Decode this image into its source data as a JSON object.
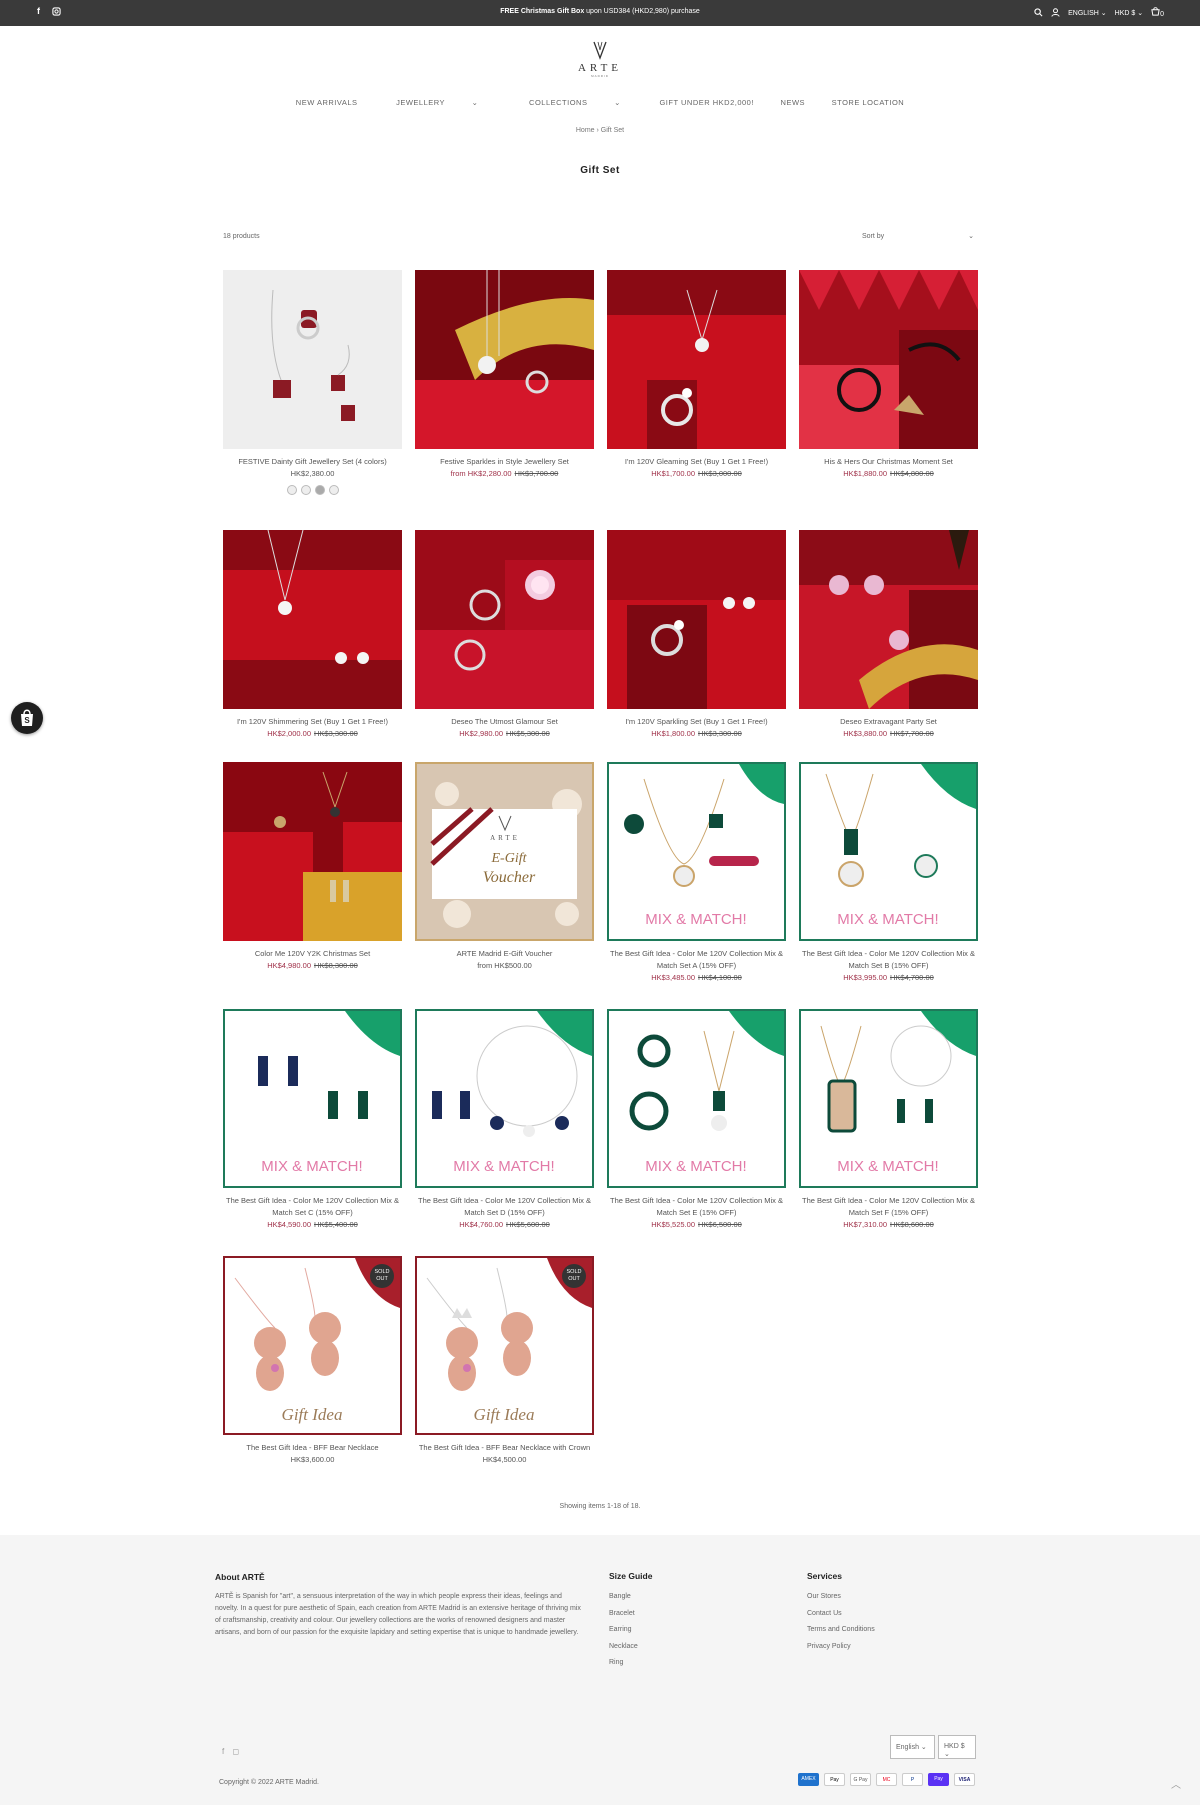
{
  "topbar": {
    "promo_bold": "FREE Christmas Gift Box",
    "promo_rest": " upon USD384 (HKD2,980) purchase",
    "language": "ENGLISH",
    "currency": "HKD $",
    "cart_count": "0"
  },
  "logo": {
    "text": "ARTE",
    "sub": "MADRID"
  },
  "nav": [
    "NEW ARRIVALS",
    "JEWELLERY",
    "COLLECTIONS",
    "GIFT UNDER HKD2,000!",
    "NEWS",
    "STORE LOCATION"
  ],
  "breadcrumb": "Home › Gift Set",
  "page_title": "Gift Set",
  "product_count": "18 products",
  "sort_label": "Sort by",
  "products": [
    {
      "name": "FESTIVE Dainty Gift Jewellery Set (4 colors)",
      "price": "HK$2,380.00",
      "compare": "",
      "prefix": ""
    },
    {
      "name": "Festive Sparkles in Style Jewellery Set",
      "price": "HK$2,280.00",
      "compare": "HK$3,700.00",
      "prefix": "from "
    },
    {
      "name": "I'm 120V Gleaming Set (Buy 1 Get 1 Free!)",
      "price": "HK$1,700.00",
      "compare": "HK$3,000.00",
      "prefix": ""
    },
    {
      "name": "His & Hers Our Christmas Moment Set",
      "price": "HK$1,880.00",
      "compare": "HK$4,800.00",
      "prefix": ""
    },
    {
      "name": "I'm 120V Shimmering Set (Buy 1 Get 1 Free!)",
      "price": "HK$2,000.00",
      "compare": "HK$3,300.00",
      "prefix": ""
    },
    {
      "name": "Deseo The Utmost Glamour Set",
      "price": "HK$2,980.00",
      "compare": "HK$5,300.00",
      "prefix": ""
    },
    {
      "name": "I'm 120V Sparkling Set (Buy 1 Get 1 Free!)",
      "price": "HK$1,800.00",
      "compare": "HK$3,300.00",
      "prefix": ""
    },
    {
      "name": "Deseo Extravagant Party Set",
      "price": "HK$3,880.00",
      "compare": "HK$7,700.00",
      "prefix": ""
    },
    {
      "name": "Color Me 120V Y2K Christmas Set",
      "price": "HK$4,980.00",
      "compare": "HK$8,300.00",
      "prefix": ""
    },
    {
      "name": "ARTE Madrid E-Gift Voucher",
      "price": "HK$500.00",
      "compare": "",
      "prefix": "from "
    },
    {
      "name": "The Best Gift Idea - Color Me 120V Collection Mix & Match Set A (15% OFF)",
      "price": "HK$3,485.00",
      "compare": "HK$4,100.00",
      "prefix": ""
    },
    {
      "name": "The Best Gift Idea - Color Me 120V Collection Mix & Match Set B (15% OFF)",
      "price": "HK$3,995.00",
      "compare": "HK$4,700.00",
      "prefix": ""
    },
    {
      "name": "The Best Gift Idea - Color Me 120V Collection Mix & Match Set C (15% OFF)",
      "price": "HK$4,590.00",
      "compare": "HK$5,400.00",
      "prefix": ""
    },
    {
      "name": "The Best Gift Idea - Color Me 120V Collection Mix & Match Set D (15% OFF)",
      "price": "HK$4,760.00",
      "compare": "HK$5,600.00",
      "prefix": ""
    },
    {
      "name": "The Best Gift Idea - Color Me 120V Collection Mix & Match Set E (15% OFF)",
      "price": "HK$5,525.00",
      "compare": "HK$6,500.00",
      "prefix": ""
    },
    {
      "name": "The Best Gift Idea - Color Me 120V Collection Mix & Match Set F (15% OFF)",
      "price": "HK$7,310.00",
      "compare": "HK$8,600.00",
      "prefix": ""
    },
    {
      "name": "The Best Gift Idea - BFF Bear Necklace",
      "price": "HK$3,600.00",
      "compare": "",
      "prefix": ""
    },
    {
      "name": "The Best Gift Idea - BFF Bear Necklace with Crown",
      "price": "HK$4,500.00",
      "compare": "",
      "prefix": ""
    }
  ],
  "images": {
    "mix_text": "MIX & MATCH!",
    "gift_idea": "Gift Idea",
    "voucher_line1": "E-Gift",
    "voucher_line2": "Voucher",
    "sold_out": "SOLD OUT"
  },
  "showing": "Showing items 1-18 of 18.",
  "footer": {
    "about_title": "About ARTĚ",
    "about_text": "ARTĚ is Spanish for \"art\", a sensuous interpretation of the way in which people express their ideas, feelings and novelty. In a quest for pure aesthetic of Spain, each creation from ARTE Madrid is an extensive heritage of thriving mix of craftsmanship, creativity and colour. Our jewellery collections are the works of renowned designers and master artisans, and born of our passion for the exquisite lapidary and setting expertise that is unique to handmade jewellery.",
    "size_title": "Size Guide",
    "size_items": [
      "Bangle",
      "Bracelet",
      "Earring",
      "Necklace",
      "Ring"
    ],
    "services_title": "Services",
    "services_items": [
      "Our Stores",
      "Contact Us",
      "Terms and Conditions",
      "Privacy Policy"
    ],
    "language": "English",
    "currency": "HKD $",
    "copyright": "Copyright © 2022 ARTE Madrid."
  },
  "payments": [
    "AMEX",
    "Pay",
    "G Pay",
    "MC",
    "P",
    "Pay",
    "VISA"
  ]
}
